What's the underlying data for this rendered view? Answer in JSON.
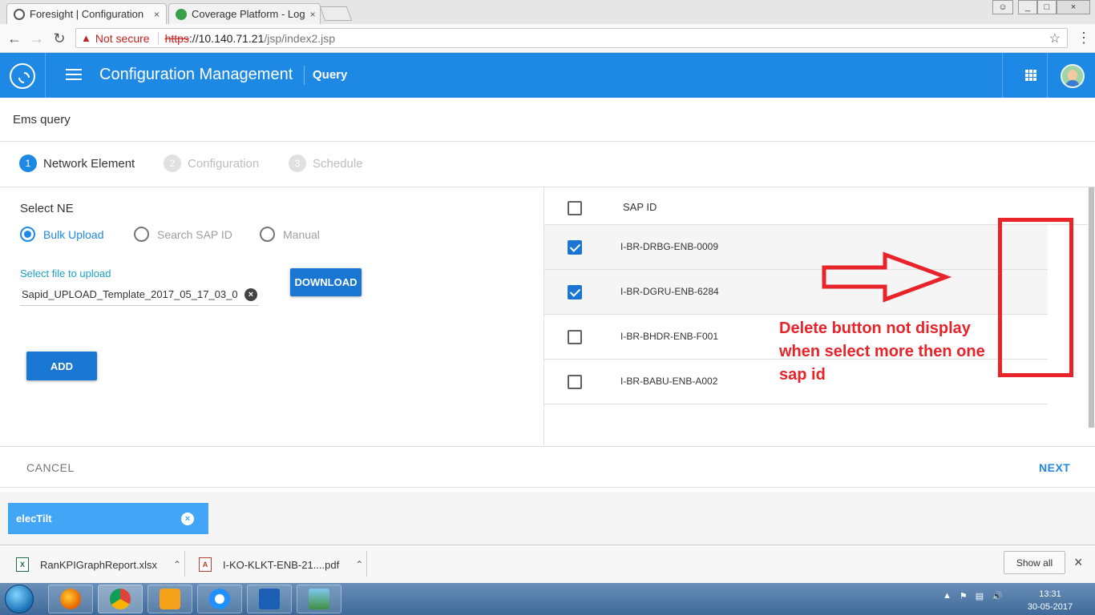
{
  "browser": {
    "tabs": [
      {
        "title": "Foresight | Configuration",
        "close": "×"
      },
      {
        "title": "Coverage Platform - Log",
        "close": "×"
      }
    ],
    "window_buttons": [
      "_",
      "□",
      "×"
    ],
    "security_label": "Not secure",
    "url_scheme": "https",
    "url_host": "://10.140.71.21",
    "url_path": "/jsp/index2.jsp"
  },
  "header": {
    "title": "Configuration Management",
    "nav_link": "Query"
  },
  "page": {
    "title": "Ems query",
    "steps": [
      {
        "num": "1",
        "label": "Network Element",
        "state": "active"
      },
      {
        "num": "2",
        "label": "Configuration",
        "state": "inactive"
      },
      {
        "num": "3",
        "label": "Schedule",
        "state": "inactive"
      }
    ],
    "select_ne_label": "Select NE",
    "radio_options": [
      {
        "label": "Bulk Upload",
        "checked": true
      },
      {
        "label": "Search SAP ID",
        "checked": false
      },
      {
        "label": "Manual",
        "checked": false
      }
    ],
    "file_label": "Select file to upload",
    "file_value": "Sapid_UPLOAD_Template_2017_05_17_03_0",
    "download_button": "DOWNLOAD",
    "add_button": "ADD",
    "table": {
      "header": "SAP ID",
      "rows": [
        {
          "sap_id": "I-BR-DRBG-ENB-0009",
          "checked": true
        },
        {
          "sap_id": "I-BR-DGRU-ENB-6284",
          "checked": true
        },
        {
          "sap_id": "I-BR-BHDR-ENB-F001",
          "checked": false
        },
        {
          "sap_id": "I-BR-BABU-ENB-A002",
          "checked": false
        }
      ]
    },
    "annotation": "Delete button not display when select more then one sap id",
    "cancel_button": "CANCEL",
    "next_button": "NEXT",
    "chip": {
      "label": "elecTilt",
      "close": "×"
    }
  },
  "downloads": {
    "items": [
      {
        "name": "RanKPIGraphReport.xlsx",
        "icon": "excel-file-icon"
      },
      {
        "name": "I-KO-KLKT-ENB-21....pdf",
        "icon": "pdf-file-icon"
      }
    ],
    "show_all": "Show all",
    "close": "×"
  },
  "taskbar": {
    "time": "13:31",
    "date": "30-05-2017"
  },
  "colors": {
    "primary": "#1e88e5",
    "annotation": "#e8232a",
    "chip": "#42a5f5"
  }
}
